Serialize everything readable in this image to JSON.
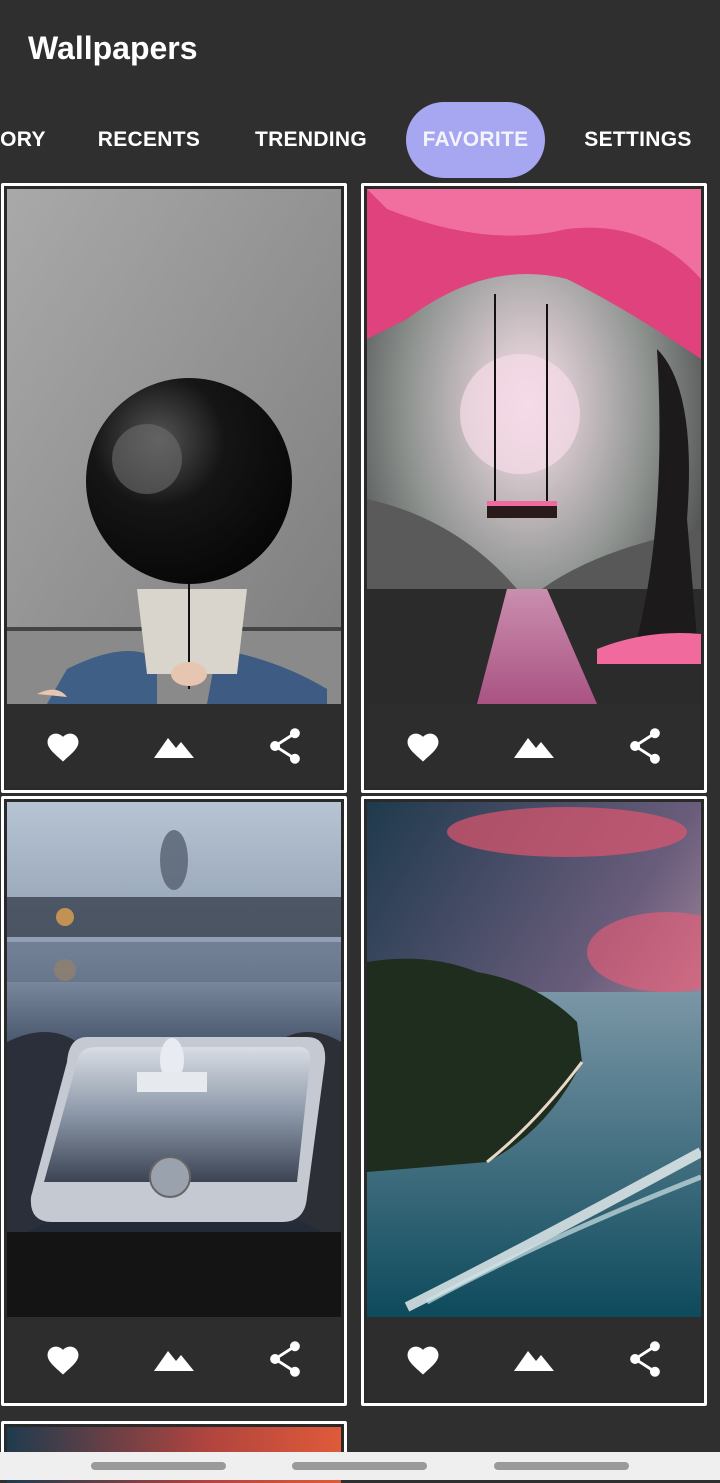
{
  "app": {
    "title": "Wallpapers"
  },
  "tabs": [
    {
      "label": "ORY",
      "active": false
    },
    {
      "label": "RECENTS",
      "active": false
    },
    {
      "label": "TRENDING",
      "active": false
    },
    {
      "label": "FAVORITE",
      "active": true
    },
    {
      "label": "SETTINGS",
      "active": false
    }
  ],
  "colors": {
    "background": "#2f2f2f",
    "active_tab": "#a7a6f0",
    "card_border": "#ffffff",
    "icon": "#ffffff"
  },
  "cards": [
    {
      "image": "black-balloon-person",
      "actions": [
        "heart-icon",
        "image-icon",
        "share-icon"
      ]
    },
    {
      "image": "pink-tree-swing-painting",
      "actions": [
        "heart-icon",
        "image-icon",
        "share-icon"
      ]
    },
    {
      "image": "capitol-reflection-phone",
      "actions": [
        "heart-icon",
        "image-icon",
        "share-icon"
      ]
    },
    {
      "image": "coast-speedboat-sunset",
      "actions": [
        "heart-icon",
        "image-icon",
        "share-icon"
      ]
    },
    {
      "image": "sunset-partial",
      "actions": []
    }
  ],
  "system_nav": [
    "recents-pill",
    "home-pill",
    "back-pill"
  ]
}
